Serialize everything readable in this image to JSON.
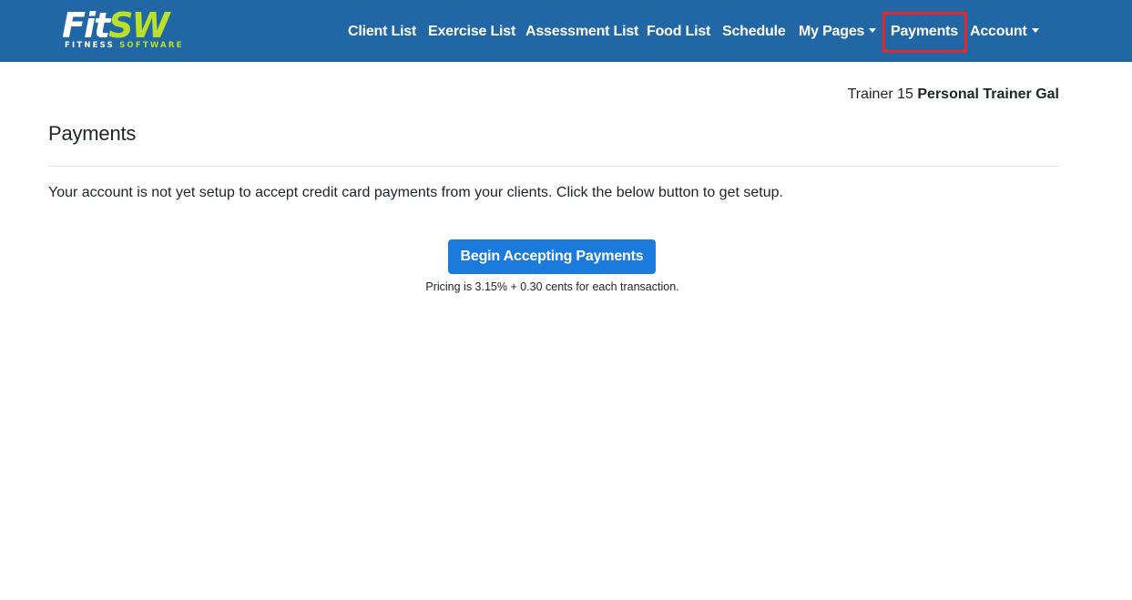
{
  "app": {
    "logo": {
      "main_white": "Fit",
      "main_green": "SW",
      "sub_white": "FITNESS ",
      "sub_green": "SOFTWARE"
    }
  },
  "nav": {
    "items": [
      {
        "label": "Client List"
      },
      {
        "label": "Exercise List"
      },
      {
        "label": "Assessment List"
      },
      {
        "label": "Food List"
      },
      {
        "label": "Schedule"
      },
      {
        "label": "My Pages",
        "dropdown": true
      },
      {
        "label": "Payments",
        "highlighted": true
      },
      {
        "label": "Account",
        "dropdown": true
      }
    ],
    "highlight_color": "#e4262b"
  },
  "user": {
    "prefix": "Trainer 15",
    "name": "Personal Trainer Gal"
  },
  "main": {
    "title": "Payments",
    "info": "Your account is not yet setup to accept credit card payments from your clients. Click the below button to get setup.",
    "button_label": "Begin Accepting Payments",
    "pricing_note": "Pricing is 3.15% + 0.30 cents for each transaction."
  },
  "colors": {
    "navbar": "#2167a6",
    "brand_green": "#b9e02a",
    "button": "#1a7bdc"
  }
}
